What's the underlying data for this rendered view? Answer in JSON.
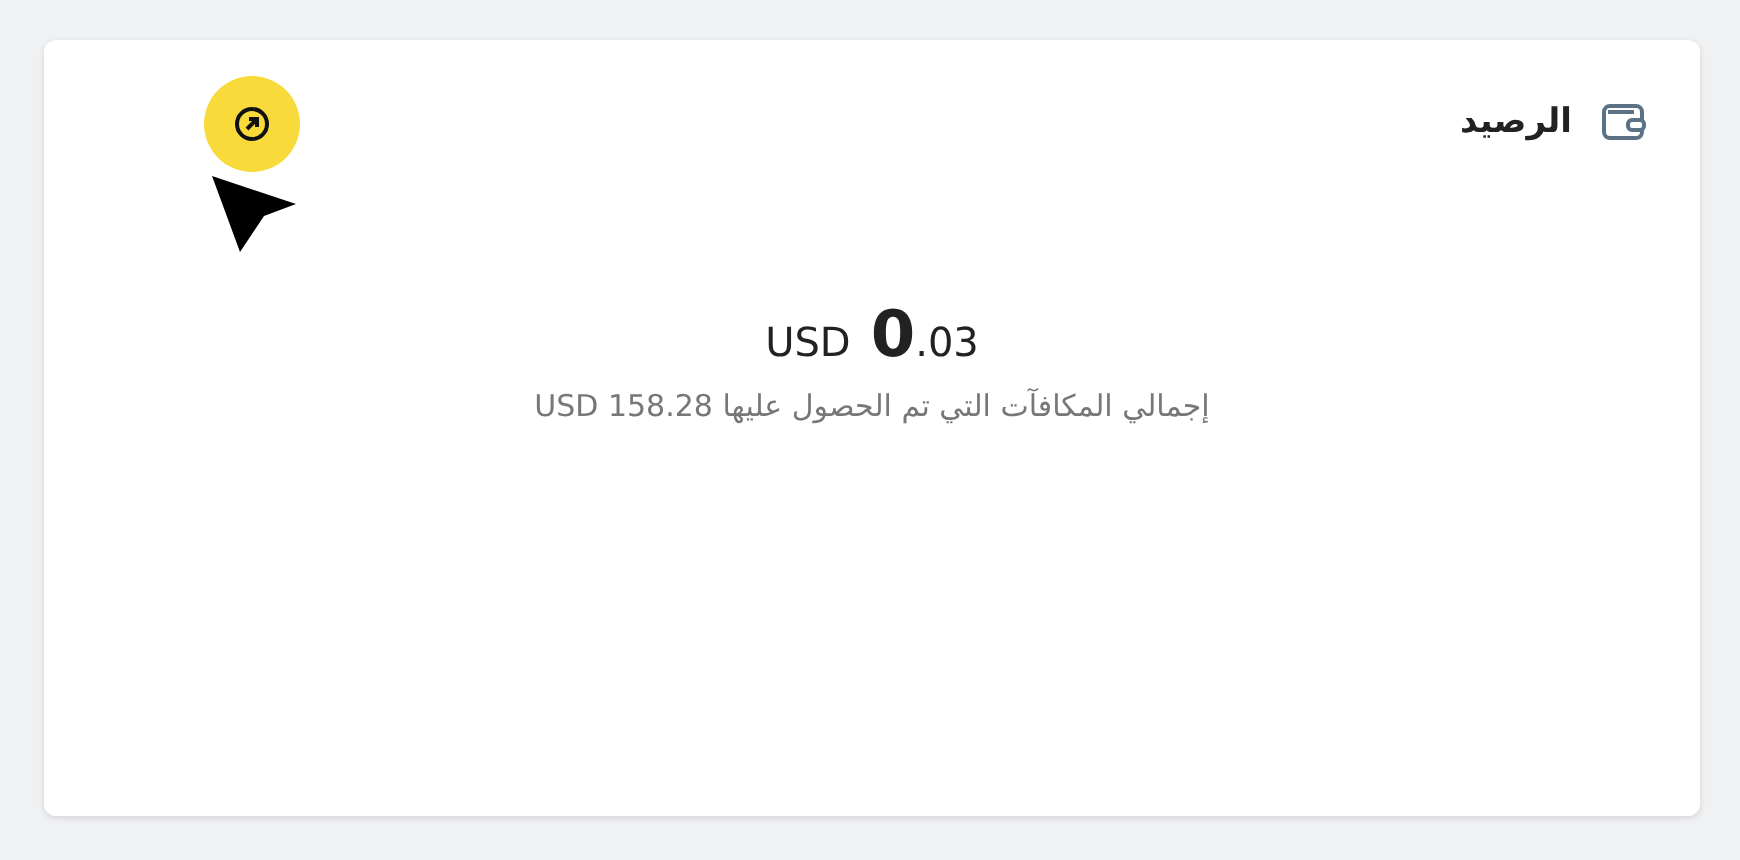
{
  "card": {
    "title": "الرصيد",
    "balance": {
      "currency": "USD",
      "integer": "0",
      "fraction": ".03"
    },
    "total_rewards": "إجمالي المكافآت التي تم الحصول عليها USD 158.28"
  }
}
